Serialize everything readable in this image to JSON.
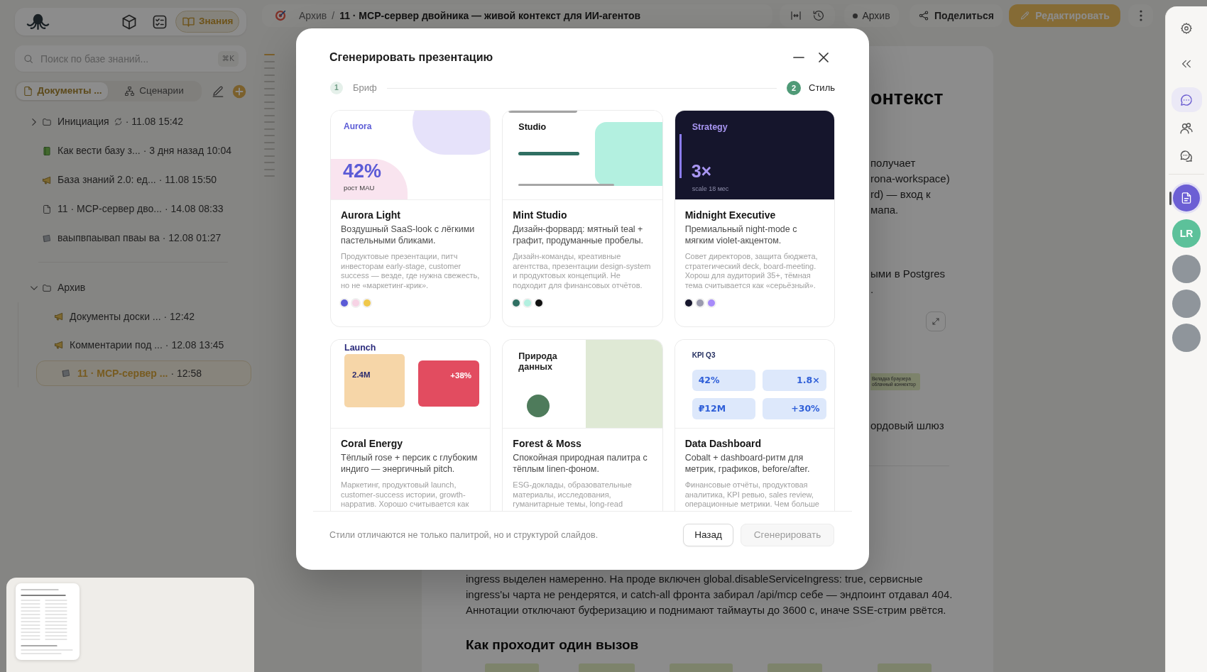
{
  "app_nav": [
    {
      "kind": "cube",
      "selected": false
    },
    {
      "kind": "checklist",
      "selected": false
    },
    {
      "kind": "book",
      "label": "Знания",
      "selected": true
    }
  ],
  "search": {
    "placeholder": "Поиск по базе знаний...",
    "shortcut": "⌘K"
  },
  "sidebar_tabs": [
    {
      "kind": "page",
      "label": "Документы ...",
      "selected": true
    },
    {
      "kind": "hierarchy",
      "label": "Сценарии",
      "selected": false
    }
  ],
  "tree_sections": [
    {
      "items": [
        {
          "kind": "folder",
          "title": "Инициация",
          "meta": "· 11.08 15:42",
          "syncing": true,
          "expanded": false,
          "selected": false
        },
        {
          "kind": "book",
          "title": "Как вести базу з...",
          "meta": "· 3 дня назад 10:04",
          "syncing": false,
          "selected": false
        },
        {
          "kind": "megaphone",
          "title": "База знаний 2.0: ед...",
          "meta": "· 11.08 15:50",
          "syncing": false,
          "selected": false
        },
        {
          "kind": "page",
          "title": "11 · MCP-сервер дво...",
          "meta": "· 14.08 08:33",
          "syncing": false,
          "selected": false
        },
        {
          "kind": "board",
          "title": "ваыпвпаывап пваы ва",
          "meta": "· 12.08 01:27",
          "syncing": false,
          "selected": false
        }
      ]
    },
    {
      "items": [
        {
          "kind": "folder",
          "title": "Архив",
          "syncing": false,
          "expanded": true,
          "selected": false,
          "children": [
            {
              "kind": "megaphone",
              "title": "Документы доски ...",
              "meta": "· 12:42",
              "syncing": false,
              "selected": false
            },
            {
              "kind": "megaphone",
              "title": "Комментарии под ...",
              "meta": "· 12.08 13:45",
              "syncing": false,
              "selected": false
            },
            {
              "kind": "board",
              "title": "11 · MCP-сервер ...",
              "meta": "· 12:58",
              "syncing": false,
              "selected": true
            }
          ]
        }
      ]
    }
  ],
  "outline_markers": [
    {
      "selected": true
    },
    {
      "selected": false
    },
    {
      "selected": false
    },
    {
      "selected": false
    },
    {
      "selected": false
    },
    {
      "selected": false
    },
    {
      "selected": false
    },
    {
      "selected": false
    },
    {
      "selected": false
    },
    {
      "selected": false
    },
    {
      "selected": false
    },
    {
      "selected": false
    },
    {
      "selected": false
    },
    {
      "selected": false
    },
    {
      "selected": false
    },
    {
      "selected": false
    },
    {
      "selected": false
    },
    {
      "selected": false
    },
    {
      "selected": false
    }
  ],
  "topbar": {
    "breadcrumb": [
      {
        "label": "Архив"
      },
      {
        "label": "11 · MCP-сервер двойника — живой контекст для ИИ-агентов"
      }
    ],
    "separator": "/",
    "status": "Архив",
    "share": "Поделиться",
    "edit": "Редактировать"
  },
  "document": {
    "title_fragment": "онтекст",
    "upper_fragment_lines": [
      "получает",
      "rona-workspace)",
      "rd) — вход к",
      "мапа."
    ],
    "middle_fragment_lines": [
      "ыми в Postgres",
      "."
    ],
    "diagram_node_lines": [
      "Вкладка браузера",
      "облачный коннектор"
    ],
    "lower_fragment": "ордовый шлюз",
    "body_lines": [
      "ingress выделен намеренно. На проде включен global.disableServiceIngress: true, сервисные",
      "ingress'ы чарта не рендерятся, и catch-all фронта забирал /api/mcp себе — эндпоинт отдавал 404.",
      "Аннотации отключают буферизацию и поднимают таймауты до 3600 с, иначе SSE-стрим рвётся."
    ],
    "heading": "Как проходит один вызов"
  },
  "rail": {
    "tools": [
      {
        "kind": "chat",
        "selected": true
      },
      {
        "kind": "people",
        "selected": false
      },
      {
        "kind": "chats",
        "selected": false
      }
    ],
    "participants": [
      {
        "kind": "document",
        "selected": true
      },
      {
        "kind": "initials",
        "label": "LR",
        "selected": false
      },
      {
        "kind": "photo",
        "selected": false
      },
      {
        "kind": "photo",
        "selected": false
      },
      {
        "kind": "photo",
        "selected": false
      }
    ]
  },
  "modal": {
    "title": "Сгенерировать презентацию",
    "steps": [
      {
        "number": "1",
        "label": "Бриф",
        "selected": false
      },
      {
        "number": "2",
        "label": "Стиль",
        "selected": true
      }
    ],
    "styles": [
      {
        "name": "Aurora Light",
        "tagline": "Воздушный SaaS-look с лёгкими пастельными бликами.",
        "use_cases": "Продуктовые презентации, питч инвесторам early-stage, customer success — везде, где нужна свежесть, но не «маркетинг-крик».",
        "selected": false,
        "preview": {
          "kind": "aurora",
          "label": "Aurora",
          "value": "42%",
          "caption": "рост MAU"
        },
        "palette": [
          {
            "color": "#5b5bd6"
          },
          {
            "color": "#f7d3e5"
          },
          {
            "color": "#f0c84a"
          }
        ]
      },
      {
        "name": "Mint Studio",
        "tagline": "Дизайн-форвард: мятный teal + графит, продуманные пробелы.",
        "use_cases": "Дизайн-команды, креативные агентства, презентации design-system и продуктовых концепций. Не подходит для финансовых отчётов.",
        "selected": false,
        "preview": {
          "kind": "studio",
          "label": "Studio"
        },
        "palette": [
          {
            "color": "#2f6f62"
          },
          {
            "color": "#b3f0e0"
          },
          {
            "color": "#111111"
          }
        ]
      },
      {
        "name": "Midnight Executive",
        "tagline": "Премиальный night-mode с мягким violet-акцентом.",
        "use_cases": "Совет директоров, защита бюджета, стратегический deck, board-meeting. Хорош для аудиторий 35+, тёмная тема считывается как «серьёзный».",
        "selected": false,
        "preview": {
          "kind": "midnight",
          "label": "Strategy",
          "value": "3×",
          "caption": "scale 18 мес"
        },
        "palette": [
          {
            "color": "#15152c"
          },
          {
            "color": "#9a9aae"
          },
          {
            "color": "#a78bfa"
          }
        ]
      },
      {
        "name": "Coral Energy",
        "tagline": "Тёплый rose + персик с глубоким индиго — энергичный pitch.",
        "use_cases": "Маркетинг, продуктовый launch, customer-success истории, growth-нарратив. Хорошо считывается как",
        "selected": false,
        "preview": {
          "kind": "launch",
          "label": "Launch",
          "values": [
            "2.4M",
            "+38%"
          ]
        }
      },
      {
        "name": "Forest & Moss",
        "tagline": "Спокойная природная палитра с тёплым linen-фоном.",
        "use_cases": "ESG-доклады, образовательные материалы, исследования, гуманитарные темы, long-read",
        "selected": false,
        "preview": {
          "kind": "nature",
          "label": "Природа данных"
        }
      },
      {
        "name": "Data Dashboard",
        "tagline": "Cobalt + dashboard-ритм для метрик, графиков, before/after.",
        "use_cases": "Финансовые отчёты, продуктовая аналитика, KPI ревью, sales review, операционные метрики. Чем больше",
        "selected": false,
        "preview": {
          "kind": "kpi",
          "label": "KPI Q3",
          "values": [
            "42%",
            "1.8×",
            "₽12M",
            "+30%"
          ]
        }
      }
    ],
    "footer_note": "Стили отличаются не только палитрой, но и структурой слайдов.",
    "buttons": [
      {
        "label": "Назад",
        "disabled": false
      },
      {
        "label": "Сгенерировать",
        "disabled": true
      }
    ]
  }
}
